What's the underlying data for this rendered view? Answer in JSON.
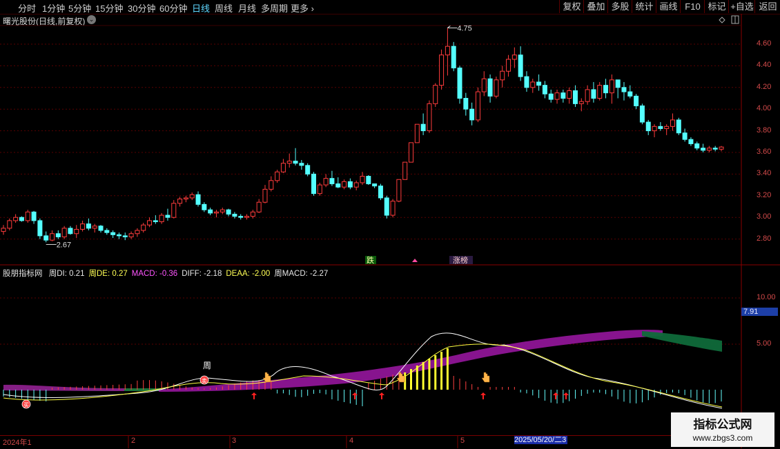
{
  "toolbar": {
    "timeframes": [
      "分时",
      "1分钟",
      "5分钟",
      "15分钟",
      "30分钟",
      "60分钟",
      "日线",
      "周线",
      "月线",
      "多周期",
      "更多"
    ],
    "active_timeframe": "日线",
    "right_buttons": [
      "复权",
      "叠加",
      "多股",
      "统计",
      "画线",
      "F10",
      "标记",
      "+自选",
      "返回"
    ]
  },
  "main_chart": {
    "title": "曙光股份(日线,前复权)",
    "price_ticks": [
      "4.60",
      "4.40",
      "4.20",
      "4.00",
      "3.80",
      "3.60",
      "3.40",
      "3.20",
      "3.00",
      "2.80"
    ],
    "high_label": "4.75",
    "low_label": "2.67",
    "tags": [
      "跌",
      "涨榜"
    ],
    "colors": {
      "up": "#ff3c3c",
      "down": "#54ffff",
      "grid": "#5a0000"
    }
  },
  "indicator": {
    "name": "股朋指标网",
    "values": [
      {
        "label": "周DI: 0.21",
        "color": "#e6e6e6"
      },
      {
        "label": "周DE: 0.27",
        "color": "#ffff55"
      },
      {
        "label": "MACD: -0.36",
        "color": "#ff55ff"
      },
      {
        "label": "DIFF: -2.18",
        "color": "#e6e6e6"
      },
      {
        "label": "DEAA: -2.00",
        "color": "#ffff55"
      },
      {
        "label": "周MACD: -2.27",
        "color": "#e6e6e6"
      }
    ],
    "axis_ticks": [
      "10.00",
      "5.00"
    ],
    "current_value": "7.91",
    "marker_text_week": "周",
    "marker_text_buy": "买",
    "marker_text_sell": "卖"
  },
  "date_axis": {
    "labels": [
      "2024年1",
      "2",
      "3",
      "4",
      "5"
    ],
    "highlight": "2025/05/20/二",
    "highlight_suffix": "3"
  },
  "watermark": {
    "title": "指标公式网",
    "url": "www.zbgs3.com"
  }
}
